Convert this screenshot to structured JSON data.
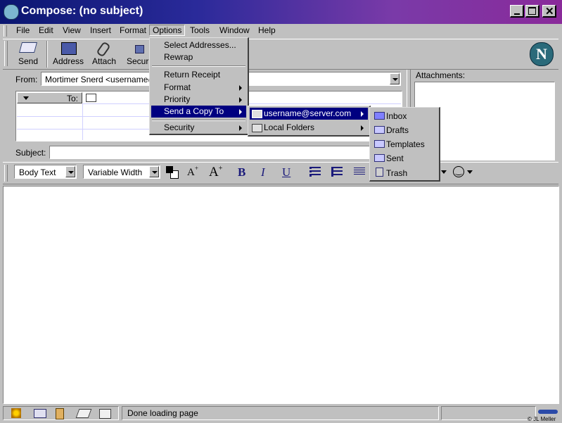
{
  "window": {
    "title": "Compose: (no subject)"
  },
  "menubar": {
    "items": [
      "File",
      "Edit",
      "View",
      "Insert",
      "Format",
      "Options",
      "Tools",
      "Window",
      "Help"
    ]
  },
  "toolbar": {
    "send": "Send",
    "address": "Address",
    "attach": "Attach",
    "security": "Securi"
  },
  "header": {
    "from_label": "From:",
    "from_value": "Mortimer Snerd <username@se",
    "to_label": "To:",
    "subject_label": "Subject:",
    "attachments_label": "Attachments:"
  },
  "options_menu": {
    "items": [
      "Select Addresses...",
      "Rewrap",
      "Return Receipt",
      "Format",
      "Priority",
      "Send a Copy To",
      "Security"
    ]
  },
  "send_copy_menu": {
    "items": [
      "username@server.com",
      "Local Folders"
    ]
  },
  "folders_menu": {
    "items": [
      "Inbox",
      "Drafts",
      "Templates",
      "Sent",
      "Trash"
    ]
  },
  "format_toolbar": {
    "paragraph": "Body Text",
    "font": "Variable Width",
    "bold": "B",
    "italic": "I",
    "underline": "U"
  },
  "statusbar": {
    "text": "Done loading page"
  },
  "copyright": "© JL Meller",
  "colors": {
    "menu_highlight": "#000080",
    "face": "#c0c0c0"
  }
}
